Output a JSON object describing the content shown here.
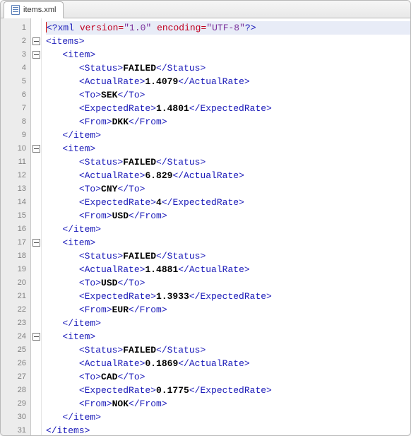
{
  "tab": {
    "filename": "items.xml"
  },
  "xml_header": {
    "version": "1.0",
    "encoding": "UTF-8"
  },
  "root_element": "items",
  "item_element": "item",
  "fields": {
    "status": "Status",
    "actual_rate": "ActualRate",
    "to": "To",
    "expected_rate": "ExpectedRate",
    "from": "From"
  },
  "items": [
    {
      "status": "FAILED",
      "actual_rate": "1.4079",
      "to": "SEK",
      "expected_rate": "1.4801",
      "from": "DKK"
    },
    {
      "status": "FAILED",
      "actual_rate": "6.829",
      "to": "CNY",
      "expected_rate": "4",
      "from": "USD"
    },
    {
      "status": "FAILED",
      "actual_rate": "1.4881",
      "to": "USD",
      "expected_rate": "1.3933",
      "from": "EUR"
    },
    {
      "status": "FAILED",
      "actual_rate": "0.1869",
      "to": "CAD",
      "expected_rate": "0.1775",
      "from": "NOK"
    }
  ],
  "chart_data": {
    "type": "table",
    "title": "items.xml",
    "columns": [
      "Status",
      "ActualRate",
      "To",
      "ExpectedRate",
      "From"
    ],
    "rows": [
      [
        "FAILED",
        1.4079,
        "SEK",
        1.4801,
        "DKK"
      ],
      [
        "FAILED",
        6.829,
        "CNY",
        4,
        "USD"
      ],
      [
        "FAILED",
        1.4881,
        "USD",
        1.3933,
        "EUR"
      ],
      [
        "FAILED",
        0.1869,
        "CAD",
        0.1775,
        "NOK"
      ]
    ]
  }
}
